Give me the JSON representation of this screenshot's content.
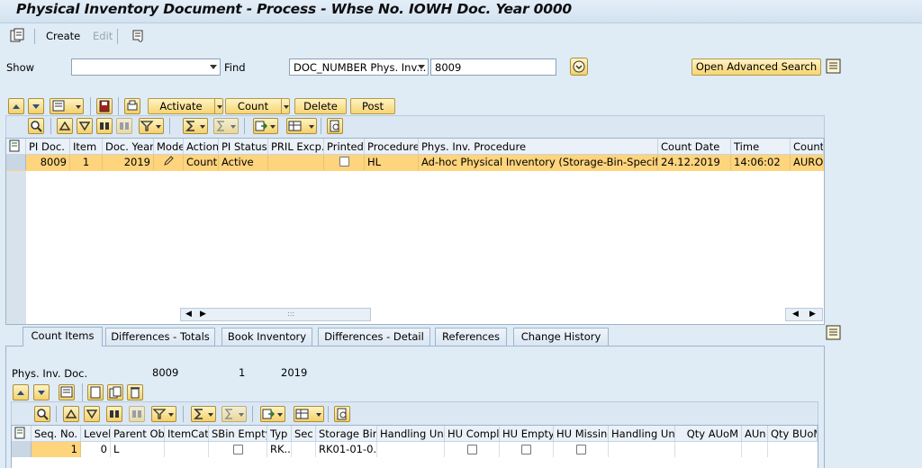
{
  "title": "Physical Inventory Document - Process - Whse No. IOWH Doc. Year 0000",
  "toolbar": {
    "create": "Create",
    "edit": "Edit"
  },
  "search": {
    "show_label": "Show",
    "show_value": "",
    "find_label": "Find",
    "find_field": "DOC_NUMBER Phys. Inv...",
    "find_value": "8009",
    "advanced_button": "Open Advanced Search"
  },
  "actions": {
    "activate": "Activate",
    "count": "Count",
    "delete": "Delete",
    "post": "Post"
  },
  "doc_table": {
    "headers": [
      "PI Doc.",
      "Item",
      "Doc. Year",
      "Mode",
      "Action",
      "PI Status",
      "PRIL Excp.",
      "Printed",
      "Procedure",
      "Phys. Inv. Procedure",
      "Count Date",
      "Time",
      "Counte"
    ],
    "row": {
      "pi_doc": "8009",
      "item": "1",
      "doc_year": "2019",
      "action": "Count",
      "pi_status": "Active",
      "pril_excp": "",
      "procedure": "HL",
      "phys_inv_procedure": "Ad-hoc Physical Inventory (Storage-Bin-Specific)",
      "count_date": "24.12.2019",
      "time": "14:06:02",
      "counter": "AURO"
    },
    "scroll_dots": ":::"
  },
  "tabs": [
    "Count Items",
    "Differences - Totals",
    "Book Inventory",
    "Differences - Detail",
    "References",
    "Change History"
  ],
  "detail": {
    "doc_label": "Phys. Inv. Doc.",
    "doc_number": "8009",
    "doc_item": "1",
    "doc_year": "2019"
  },
  "items_table": {
    "headers": [
      "Seq. No.",
      "Level",
      "Parent Obj",
      "ItemCat",
      "SBin Empty",
      "Typ",
      "Sec",
      "Storage Bin",
      "Handling Unit",
      "HU Compl.",
      "HU Empty",
      "HU Missing",
      "Handling Unit",
      "Qty AUoM",
      "AUn",
      "Qty BUoM"
    ],
    "row": {
      "seq_no": "1",
      "level": "0",
      "parent_obj": "L",
      "typ": "RK...",
      "storage_bin": "RK01-01-0..."
    }
  }
}
